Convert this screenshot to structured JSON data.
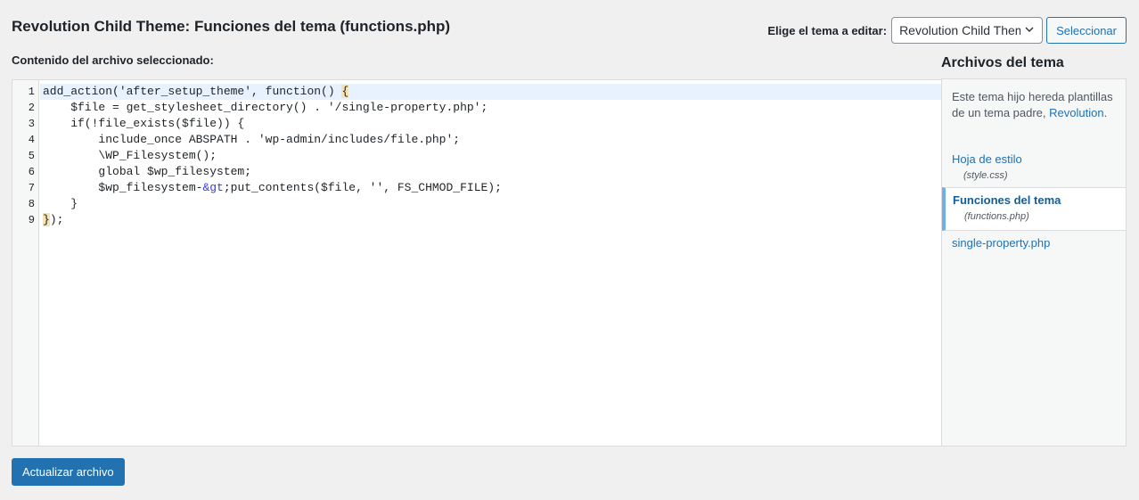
{
  "header": {
    "title": "Revolution Child Theme: Funciones del tema (functions.php)",
    "select_label": "Elige el tema a editar:",
    "select_value": "Revolution Child Theme",
    "select_button": "Seleccionar"
  },
  "editor": {
    "label": "Contenido del archivo seleccionado:",
    "lines": [
      {
        "n": "1",
        "pre": "add_action('after_setup_theme', function() ",
        "bracket": "{",
        "post": ""
      },
      {
        "n": "2",
        "text": "    $file = get_stylesheet_directory() . '/single-property.php';"
      },
      {
        "n": "3",
        "text": "    if(!file_exists($file)) {"
      },
      {
        "n": "4",
        "text": "        include_once ABSPATH . 'wp-admin/includes/file.php';"
      },
      {
        "n": "5",
        "text": "        \\WP_Filesystem();"
      },
      {
        "n": "6",
        "text": "        global $wp_filesystem;"
      },
      {
        "n": "7",
        "pre": "        $wp_filesystem-",
        "entity": "&gt",
        "post": ";put_contents($file, '', FS_CHMOD_FILE);"
      },
      {
        "n": "8",
        "text": "    }"
      },
      {
        "n": "9",
        "bracket": "}",
        "post": ");"
      }
    ]
  },
  "sidebar": {
    "title": "Archivos del tema",
    "note": "Este tema hijo hereda plantillas de un tema padre,",
    "note_link": "Revolution",
    "note_end": ".",
    "files": [
      {
        "name": "Hoja de estilo",
        "sub": "(style.css)"
      },
      {
        "name": "Funciones del tema",
        "sub": "(functions.php)"
      },
      {
        "name": "single-property.php"
      }
    ]
  },
  "footer": {
    "update_button": "Actualizar archivo"
  },
  "colors": {
    "accent": "#2271b1",
    "active_line": "#e8f2ff",
    "bracket_highlight": "#f5e3b5"
  }
}
